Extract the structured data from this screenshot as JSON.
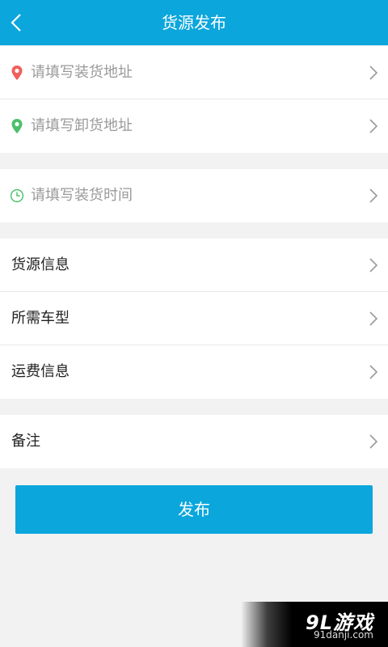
{
  "header": {
    "title": "货源发布"
  },
  "address_group": {
    "loading_address": {
      "placeholder": "请填写装货地址",
      "icon": "location-pin-icon",
      "color": "#f0615c"
    },
    "unloading_address": {
      "placeholder": "请填写卸货地址",
      "icon": "location-pin-icon",
      "color": "#4cc06a"
    }
  },
  "time_group": {
    "loading_time": {
      "placeholder": "请填写装货时间",
      "icon": "clock-icon",
      "color": "#4cc06a"
    }
  },
  "info_group": {
    "cargo_info": "货源信息",
    "vehicle_type": "所需车型",
    "freight_info": "运费信息"
  },
  "remarks_group": {
    "remarks": "备注"
  },
  "publish_button": "发布",
  "watermark": {
    "logo": "9L游戏",
    "url": "91danji.com"
  },
  "colors": {
    "accent": "#0aa6dc",
    "background": "#f2f2f2"
  }
}
